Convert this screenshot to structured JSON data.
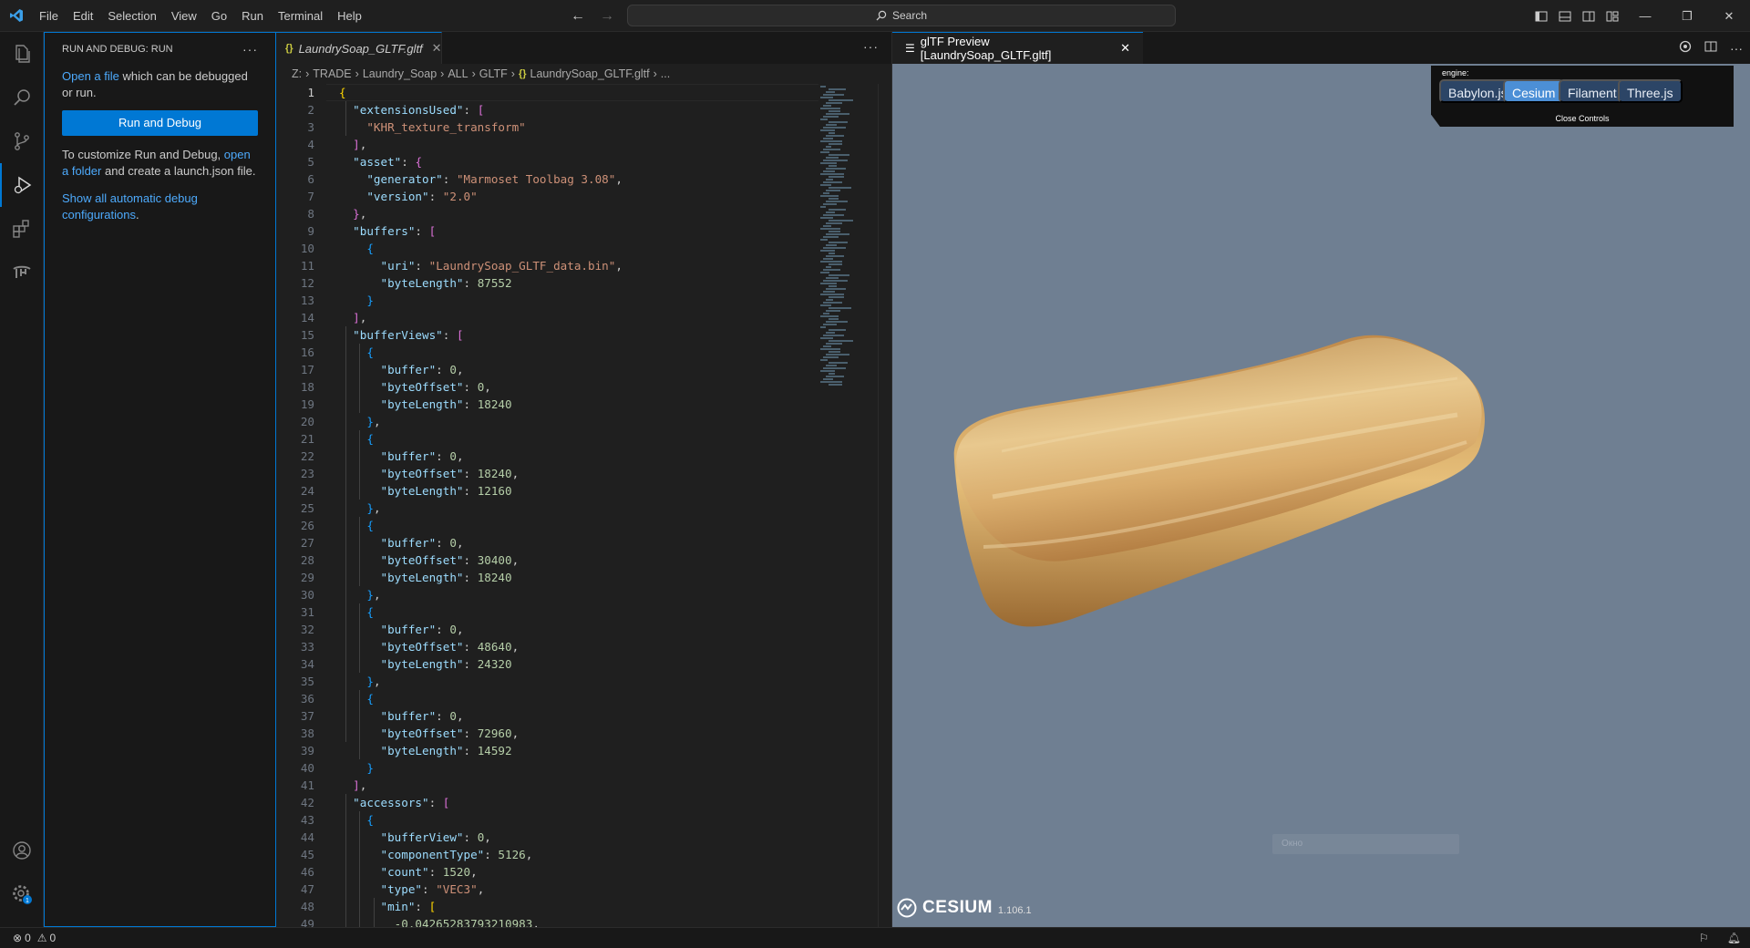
{
  "menu": [
    "File",
    "Edit",
    "Selection",
    "View",
    "Go",
    "Run",
    "Terminal",
    "Help"
  ],
  "search": {
    "label": "Search"
  },
  "sidebar": {
    "title": "RUN AND DEBUG: RUN",
    "open_file_link": "Open a file",
    "open_file_rest": " which can be debugged or run.",
    "run_button": "Run and Debug",
    "customize_pre": "To customize Run and Debug, ",
    "open_folder_link": "open a folder",
    "customize_post": " and create a launch.json file.",
    "show_all_link": "Show all automatic debug configurations",
    "show_all_post": "."
  },
  "editor": {
    "tab_label": "LaundrySoap_GLTF.gltf",
    "breadcrumbs": [
      "Z:",
      "TRADE",
      "Laundry_Soap",
      "ALL",
      "GLTF",
      "LaundrySoap_GLTF.gltf",
      "..."
    ],
    "lines": [
      "{",
      "  \"extensionsUsed\": [",
      "    \"KHR_texture_transform\"",
      "  ],",
      "  \"asset\": {",
      "    \"generator\": \"Marmoset Toolbag 3.08\",",
      "    \"version\": \"2.0\"",
      "  },",
      "  \"buffers\": [",
      "    {",
      "      \"uri\": \"LaundrySoap_GLTF_data.bin\",",
      "      \"byteLength\": 87552",
      "    }",
      "  ],",
      "  \"bufferViews\": [",
      "    {",
      "      \"buffer\": 0,",
      "      \"byteOffset\": 0,",
      "      \"byteLength\": 18240",
      "    },",
      "    {",
      "      \"buffer\": 0,",
      "      \"byteOffset\": 18240,",
      "      \"byteLength\": 12160",
      "    },",
      "    {",
      "      \"buffer\": 0,",
      "      \"byteOffset\": 30400,",
      "      \"byteLength\": 18240",
      "    },",
      "    {",
      "      \"buffer\": 0,",
      "      \"byteOffset\": 48640,",
      "      \"byteLength\": 24320",
      "    },",
      "    {",
      "      \"buffer\": 0,",
      "      \"byteOffset\": 72960,",
      "      \"byteLength\": 14592",
      "    }",
      "  ],",
      "  \"accessors\": [",
      "    {",
      "      \"bufferView\": 0,",
      "      \"componentType\": 5126,",
      "      \"count\": 1520,",
      "      \"type\": \"VEC3\",",
      "      \"min\": [",
      "        -0.04265283793210983,"
    ]
  },
  "preview": {
    "tab_label": "glTF Preview [LaundrySoap_GLTF.gltf]",
    "engine_label": "engine:",
    "engines": [
      "Babylon.js",
      "Cesium",
      "Filament",
      "Three.js"
    ],
    "selected_engine": "Cesium",
    "close_controls": "Close Controls",
    "hint_text": "Окно",
    "cesium_brand": "CESIUM",
    "cesium_version": "1.106.1"
  },
  "status": {
    "errors": "0",
    "warnings": "0",
    "notifications_badge": "1"
  },
  "colors": {
    "accent": "#0078d4",
    "viewport_bg": "#6f7f92",
    "soap": "#c8954d"
  }
}
